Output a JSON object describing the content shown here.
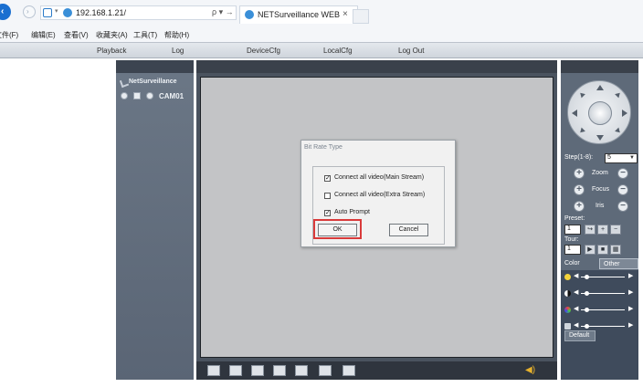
{
  "browser": {
    "address": "192.168.1.21/",
    "tab_title": "NETSurveillance WEB",
    "tab_close": "×",
    "search_glyph": "ρ ▾ →",
    "menu": [
      "文件(F)",
      "编辑(E)",
      "查看(V)",
      "收藏夹(A)",
      "工具(T)",
      "帮助(H)"
    ]
  },
  "app_nav": [
    "Playback",
    "Log",
    "DeviceCfg",
    "LocalCfg",
    "Log Out"
  ],
  "device_tree": {
    "root_label": "NetSurveillance",
    "camera_label": "CAM01"
  },
  "dialog": {
    "title": "Bit Rate Type",
    "options": [
      {
        "label": "Connect all video(Main Stream)",
        "checked": true
      },
      {
        "label": "Connect all video(Extra Stream)",
        "checked": false
      },
      {
        "label": "Auto Prompt",
        "checked": true
      }
    ],
    "ok_label": "OK",
    "cancel_label": "Cancel"
  },
  "ptz": {
    "step_label": "Step(1-8):",
    "step_value": "5",
    "controls": [
      "Zoom",
      "Focus",
      "Iris"
    ],
    "preset_label": "Preset:",
    "preset_value": "1",
    "tour_label": "Tour:",
    "tour_value": "1"
  },
  "color_panel": {
    "tab_color": "Color",
    "tab_other": "Other",
    "slider_icons": [
      "brightness-icon",
      "contrast-icon",
      "saturation-icon",
      "hue-icon"
    ],
    "default_label": "Default"
  },
  "colors": {
    "accent_red": "#d93a3a",
    "panel_dark": "#3f4b5c"
  }
}
